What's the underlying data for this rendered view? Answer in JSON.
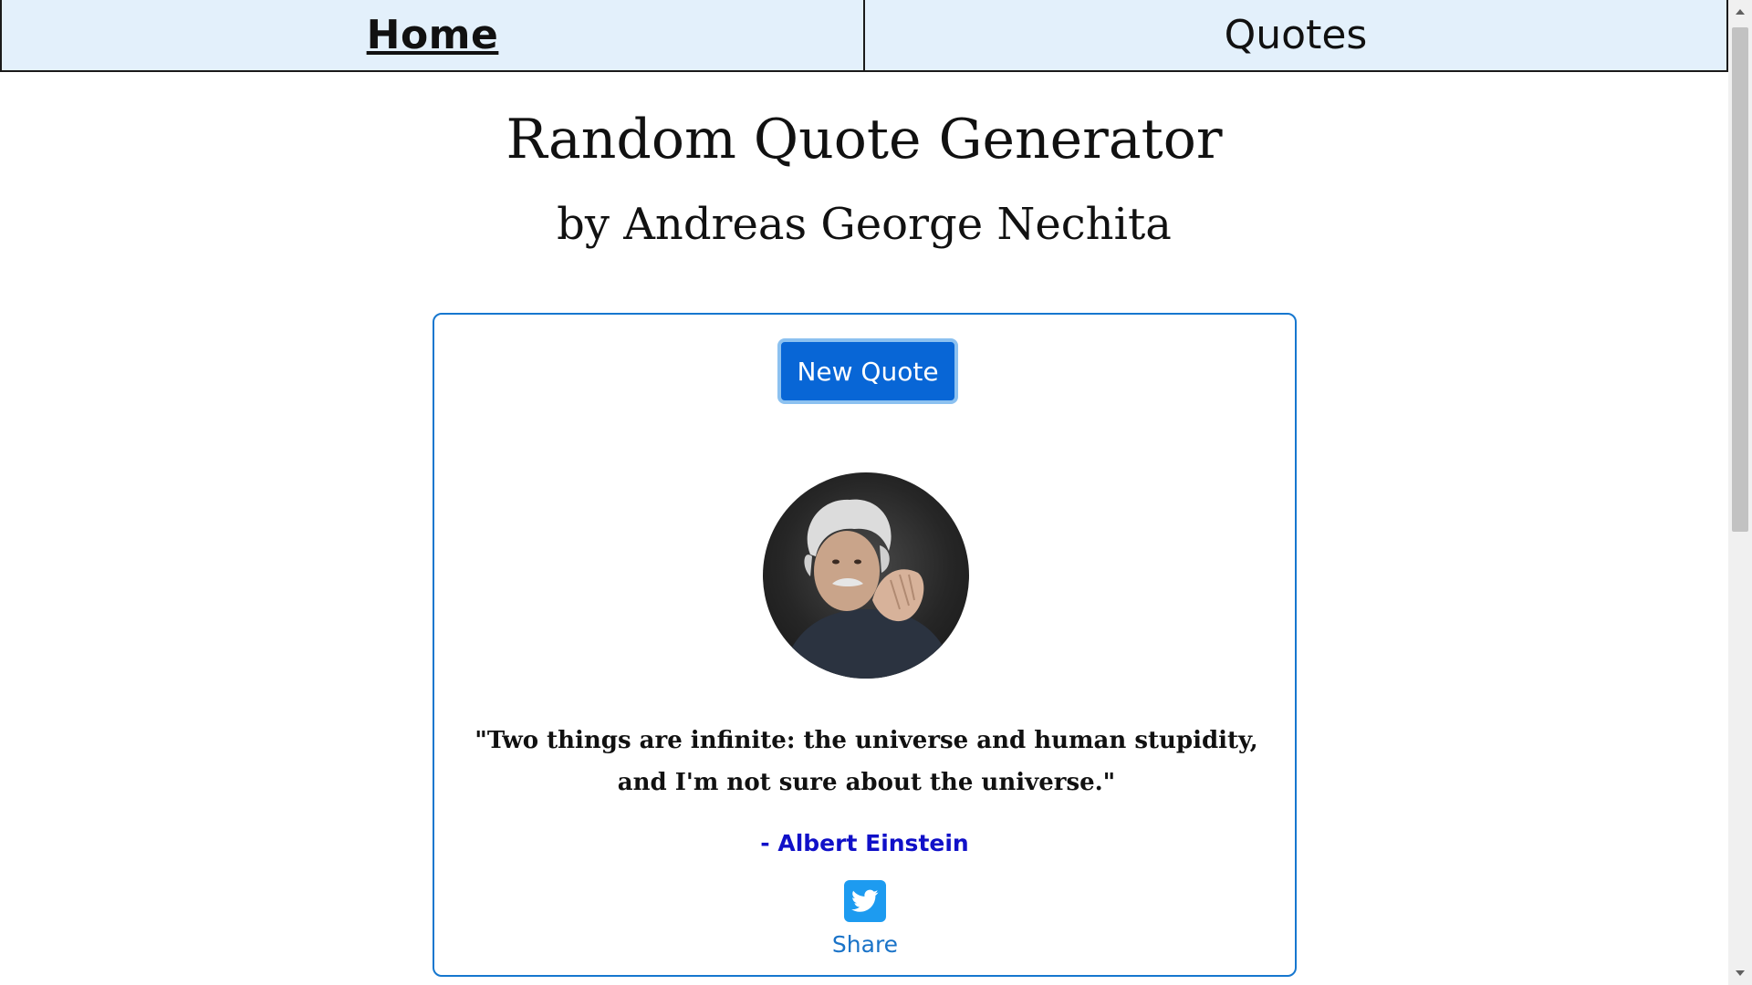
{
  "nav": {
    "home_label": "Home",
    "quotes_label": "Quotes"
  },
  "header": {
    "title": "Random Quote Generator",
    "subtitle": "by Andreas George Nechita"
  },
  "card": {
    "button_label": "New Quote",
    "quote": "\"Two things are infinite: the universe and human stupidity, and I'm not sure about the universe.\"",
    "author": "- Albert Einstein",
    "share_label": "Share",
    "share_icon": "twitter-icon",
    "portrait_icon": "author-portrait"
  },
  "colors": {
    "nav_bg": "#e3f0fb",
    "accent_button": "#0866d6",
    "card_border": "#1677cf",
    "author": "#1010c8",
    "twitter": "#1d9bf0"
  }
}
